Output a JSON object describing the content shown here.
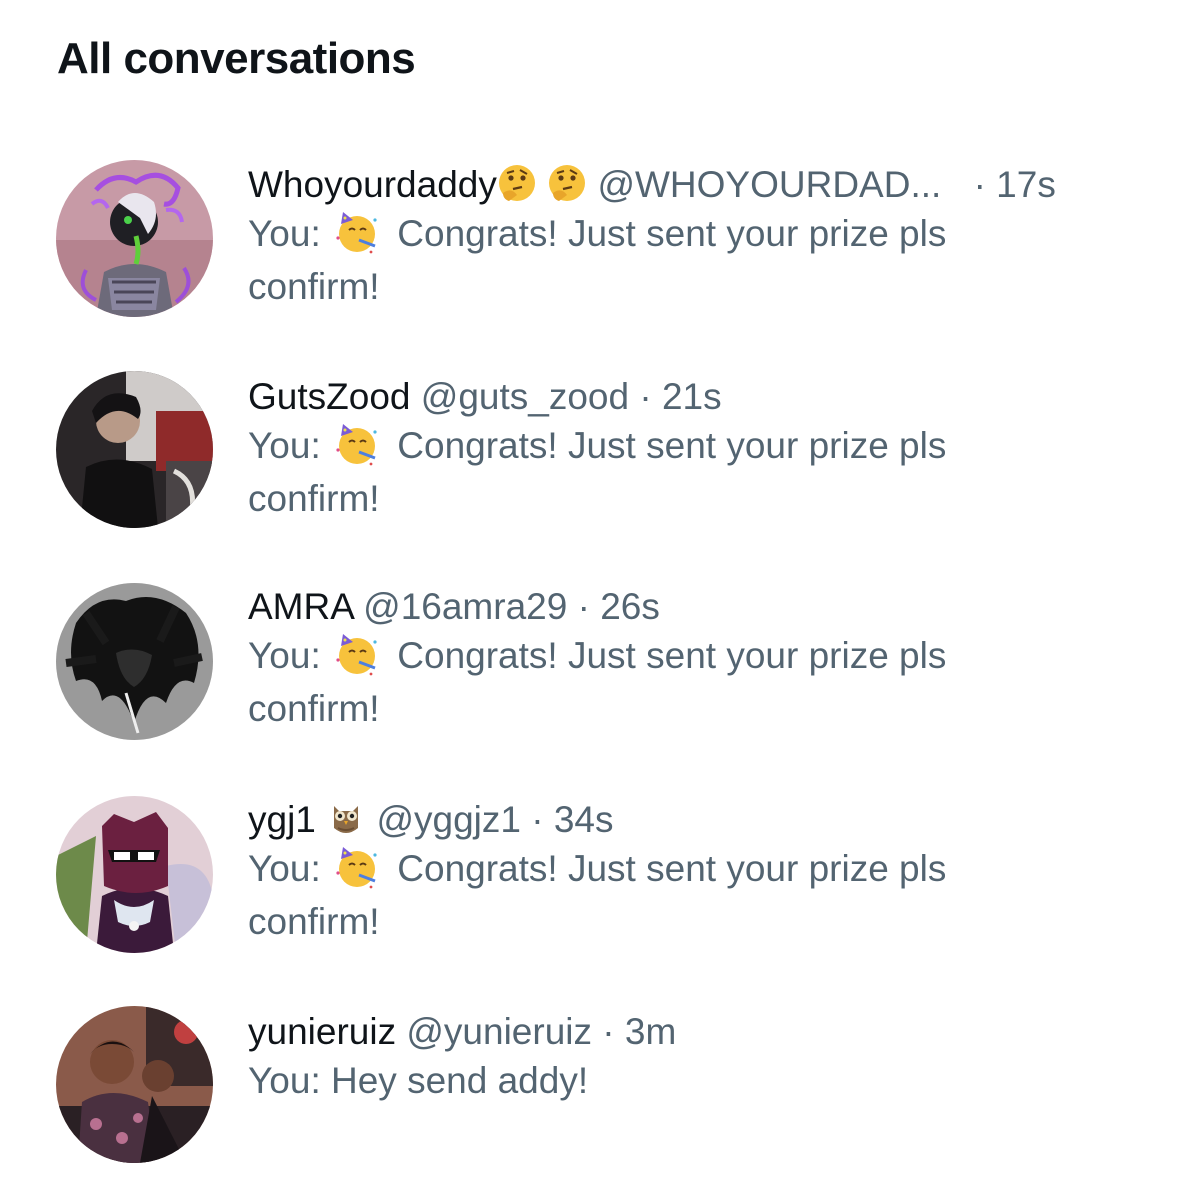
{
  "header": {
    "title": "All conversations"
  },
  "conversations": [
    {
      "name": "Whoyourdaddy",
      "name_emoji": "thinking-face-icon",
      "handle": "@WHOYOURDAD...",
      "separator": "·",
      "time": "17s",
      "prefix": "You:",
      "message_emoji": "partying-face-icon",
      "message": "Congrats! Just sent your prize pls confirm!"
    },
    {
      "name": "GutsZood",
      "handle": "@guts_zood",
      "separator": "·",
      "time": "21s",
      "prefix": "You:",
      "message_emoji": "partying-face-icon",
      "message": "Congrats! Just sent your prize pls confirm!"
    },
    {
      "name": "AMRA",
      "handle": "@16amra29",
      "separator": "·",
      "time": "26s",
      "prefix": "You:",
      "message_emoji": "partying-face-icon",
      "message": "Congrats! Just sent your prize pls confirm!"
    },
    {
      "name": "ygj1",
      "name_emoji": "owl-icon",
      "handle": "@yggjz1",
      "separator": "·",
      "time": "34s",
      "prefix": "You:",
      "message_emoji": "partying-face-icon",
      "message": "Congrats! Just sent your prize pls confirm!"
    },
    {
      "name": "yunieruiz",
      "handle": "@yunieruiz",
      "separator": "·",
      "time": "3m",
      "prefix": "You:",
      "message": "Hey send addy!"
    }
  ],
  "colors": {
    "primary_text": "#0f1419",
    "secondary_text": "#536471",
    "background": "#ffffff"
  }
}
